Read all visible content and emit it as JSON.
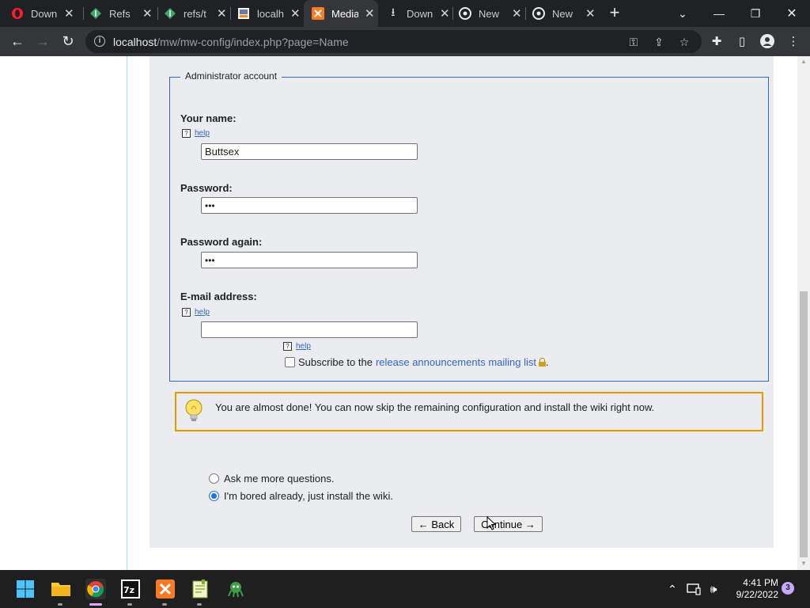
{
  "browser": {
    "tabs": [
      {
        "title": "Down",
        "icon": "opera-icon"
      },
      {
        "title": "Refs",
        "icon": "gitea-icon"
      },
      {
        "title": "refs/t",
        "icon": "gitea-icon"
      },
      {
        "title": "localh",
        "icon": "phpmyadmin-icon"
      },
      {
        "title": "Media",
        "icon": "xampp-icon"
      },
      {
        "title": "Down",
        "icon": "download-icon"
      },
      {
        "title": "New",
        "icon": "chrome-icon"
      },
      {
        "title": "New",
        "icon": "chrome-icon"
      }
    ],
    "url_host": "localhost",
    "url_path": "/mw/mw-config/index.php?page=Name"
  },
  "form": {
    "legend": "Administrator account",
    "name_label": "Your name:",
    "name_value": "Buttsex",
    "help_label": "help",
    "password_label": "Password:",
    "password_value": "•••",
    "password_again_label": "Password again:",
    "password_again_value": "•••",
    "email_label": "E-mail address:",
    "email_value": "",
    "subscribe_prefix": "Subscribe to the",
    "subscribe_link": "release announcements mailing list",
    "subscribe_suffix": "."
  },
  "notice": {
    "text": "You are almost done! You can now skip the remaining configuration and install the wiki right now."
  },
  "choices": {
    "options": [
      {
        "label": "Ask me more questions.",
        "checked": false
      },
      {
        "label": "I'm bored already, just install the wiki.",
        "checked": true
      }
    ]
  },
  "buttons": {
    "back": "← Back",
    "continue": "Continue →"
  },
  "taskbar": {
    "time": "4:41 PM",
    "date": "9/22/2022",
    "notification_count": "3"
  },
  "colors": {
    "accent_link": "#3366cc",
    "notice_border": "#e69a00",
    "config_bg": "#eaecf0"
  }
}
